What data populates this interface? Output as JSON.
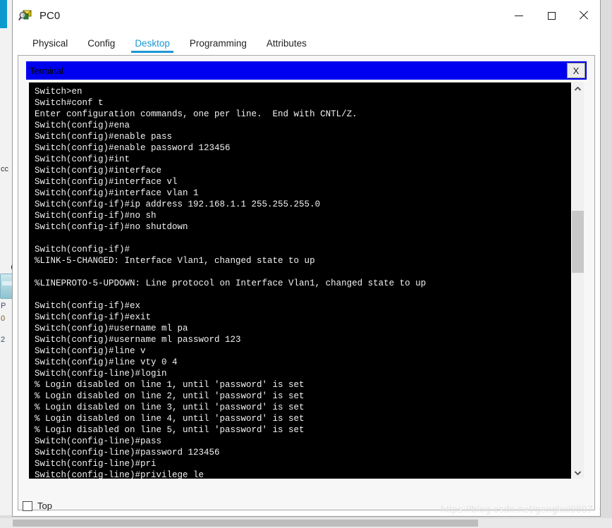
{
  "window": {
    "title": "PC0",
    "icon": "packet-tracer-inspect-icon",
    "controls": {
      "minimize": "—",
      "maximize": "□",
      "close": "✕"
    }
  },
  "tabs": [
    {
      "label": "Physical",
      "active": false
    },
    {
      "label": "Config",
      "active": false
    },
    {
      "label": "Desktop",
      "active": true
    },
    {
      "label": "Programming",
      "active": false
    },
    {
      "label": "Attributes",
      "active": false
    }
  ],
  "terminal": {
    "title": "Terminal",
    "close_label": "X",
    "titlebar_color": "#0000f0",
    "screen_bg": "#000000",
    "screen_fg": "#f2f2f2",
    "lines": [
      "Switch>en",
      "Switch#conf t",
      "Enter configuration commands, one per line.  End with CNTL/Z.",
      "Switch(config)#ena",
      "Switch(config)#enable pass",
      "Switch(config)#enable password 123456",
      "Switch(config)#int",
      "Switch(config)#interface",
      "Switch(config)#interface vl",
      "Switch(config)#interface vlan 1",
      "Switch(config-if)#ip address 192.168.1.1 255.255.255.0",
      "Switch(config-if)#no sh",
      "Switch(config-if)#no shutdown",
      "",
      "Switch(config-if)#",
      "%LINK-5-CHANGED: Interface Vlan1, changed state to up",
      "",
      "%LINEPROTO-5-UPDOWN: Line protocol on Interface Vlan1, changed state to up",
      "",
      "Switch(config-if)#ex",
      "Switch(config-if)#exit",
      "Switch(config)#username ml pa",
      "Switch(config)#username ml password 123",
      "Switch(config)#line v",
      "Switch(config)#line vty 0 4",
      "Switch(config-line)#login",
      "% Login disabled on line 1, until 'password' is set",
      "% Login disabled on line 2, until 'password' is set",
      "% Login disabled on line 3, until 'password' is set",
      "% Login disabled on line 4, until 'password' is set",
      "% Login disabled on line 5, until 'password' is set",
      "Switch(config-line)#pass",
      "Switch(config-line)#password 123456",
      "Switch(config-line)#pri",
      "Switch(config-line)#privilege le"
    ],
    "scrollbar": {
      "up_arrow": "chevron-up",
      "down_arrow": "chevron-down"
    }
  },
  "bottom": {
    "top_checkbox_label": "Top",
    "top_checkbox_checked": false
  },
  "watermark": {
    "text": "https://blog.csdn.net/gengkui9897"
  },
  "background": {
    "ghost_cc": "cc",
    "ghost_p": "P",
    "ghost_0": "0",
    "ghost_2": "2"
  }
}
